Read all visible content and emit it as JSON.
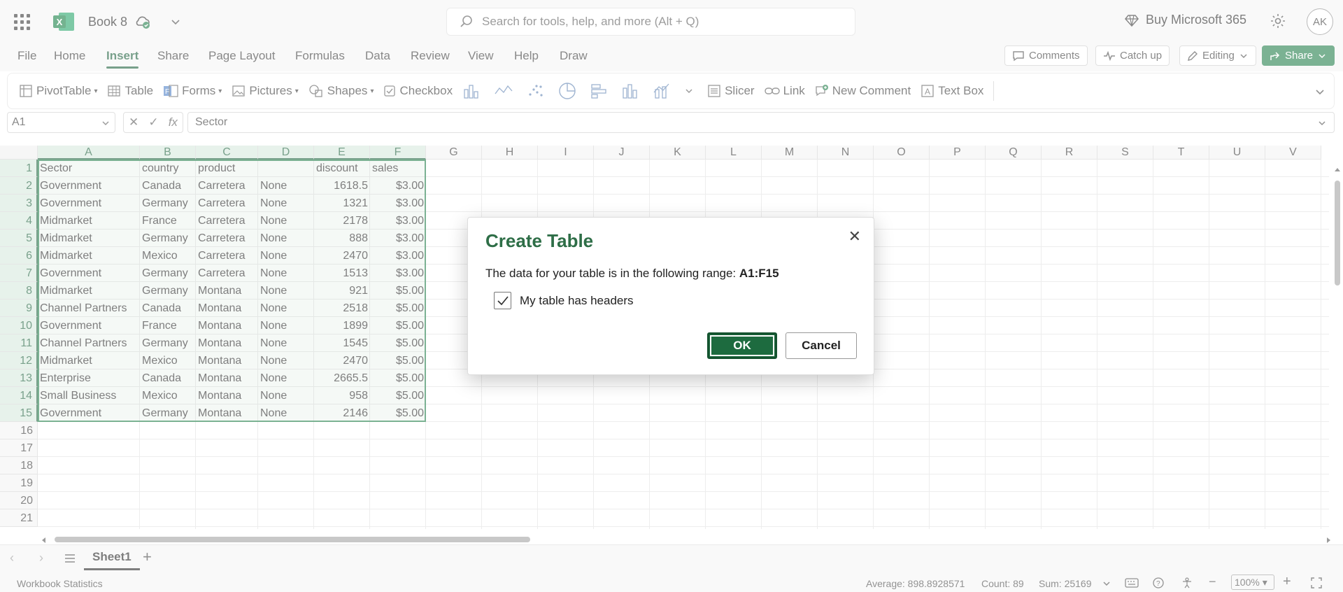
{
  "app": {
    "book_name": "Book 8",
    "search_placeholder": "Search for tools, help, and more (Alt + Q)",
    "buy_label": "Buy Microsoft 365",
    "avatar_initials": "AK"
  },
  "menu": {
    "items": [
      "File",
      "Home",
      "Insert",
      "Share",
      "Page Layout",
      "Formulas",
      "Data",
      "Review",
      "View",
      "Help",
      "Draw"
    ],
    "active": "Insert",
    "comments_label": "Comments",
    "catchup_label": "Catch up",
    "editing_label": "Editing",
    "share_label": "Share"
  },
  "ribbon": {
    "pivottable": "PivotTable",
    "table": "Table",
    "forms": "Forms",
    "pictures": "Pictures",
    "shapes": "Shapes",
    "checkbox": "Checkbox",
    "slicer": "Slicer",
    "link": "Link",
    "new_comment": "New Comment",
    "text_box": "Text Box"
  },
  "formula_bar": {
    "name_box": "A1",
    "fx": "fx",
    "value": "Sector"
  },
  "sheet": {
    "columns": [
      "A",
      "B",
      "C",
      "D",
      "E",
      "F",
      "G",
      "H",
      "I",
      "J",
      "K",
      "L",
      "M",
      "N",
      "O",
      "P",
      "Q",
      "R",
      "S",
      "T",
      "U",
      "V"
    ],
    "row_numbers": [
      "1",
      "2",
      "3",
      "4",
      "5",
      "6",
      "7",
      "8",
      "9",
      "10",
      "11",
      "12",
      "13",
      "14",
      "15",
      "16",
      "17",
      "18",
      "19",
      "20",
      "21"
    ],
    "headers": [
      "Sector",
      "country",
      "product",
      "",
      "discount",
      "sales"
    ],
    "rows": [
      [
        "Government",
        "Canada",
        "Carretera",
        "None",
        "1618.5",
        "$3.00"
      ],
      [
        "Government",
        "Germany",
        "Carretera",
        "None",
        "1321",
        "$3.00"
      ],
      [
        "Midmarket",
        "France",
        "Carretera",
        "None",
        "2178",
        "$3.00"
      ],
      [
        "Midmarket",
        "Germany",
        "Carretera",
        "None",
        "888",
        "$3.00"
      ],
      [
        "Midmarket",
        "Mexico",
        "Carretera",
        "None",
        "2470",
        "$3.00"
      ],
      [
        "Government",
        "Germany",
        "Carretera",
        "None",
        "1513",
        "$3.00"
      ],
      [
        "Midmarket",
        "Germany",
        "Montana",
        "None",
        "921",
        "$5.00"
      ],
      [
        "Channel Partners",
        "Canada",
        "Montana",
        "None",
        "2518",
        "$5.00"
      ],
      [
        "Government",
        "France",
        "Montana",
        "None",
        "1899",
        "$5.00"
      ],
      [
        "Channel Partners",
        "Germany",
        "Montana",
        "None",
        "1545",
        "$5.00"
      ],
      [
        "Midmarket",
        "Mexico",
        "Montana",
        "None",
        "2470",
        "$5.00"
      ],
      [
        "Enterprise",
        "Canada",
        "Montana",
        "None",
        "2665.5",
        "$5.00"
      ],
      [
        "Small Business",
        "Mexico",
        "Montana",
        "None",
        "958",
        "$5.00"
      ],
      [
        "Government",
        "Germany",
        "Montana",
        "None",
        "2146",
        "$5.00"
      ]
    ],
    "tab_name": "Sheet1"
  },
  "status": {
    "workbook_stats": "Workbook Statistics",
    "average": "Average: 898.8928571",
    "count": "Count: 89",
    "sum": "Sum: 25169",
    "zoom": "100%"
  },
  "dialog": {
    "title": "Create Table",
    "range_text": "The data for your table is in the following range:",
    "range_value": "A1:F15",
    "headers_checkbox_label": "My table has headers",
    "headers_checked": true,
    "ok_label": "OK",
    "cancel_label": "Cancel"
  },
  "colors": {
    "excel_green": "#1d7a46",
    "title_green": "#2e6e47"
  }
}
